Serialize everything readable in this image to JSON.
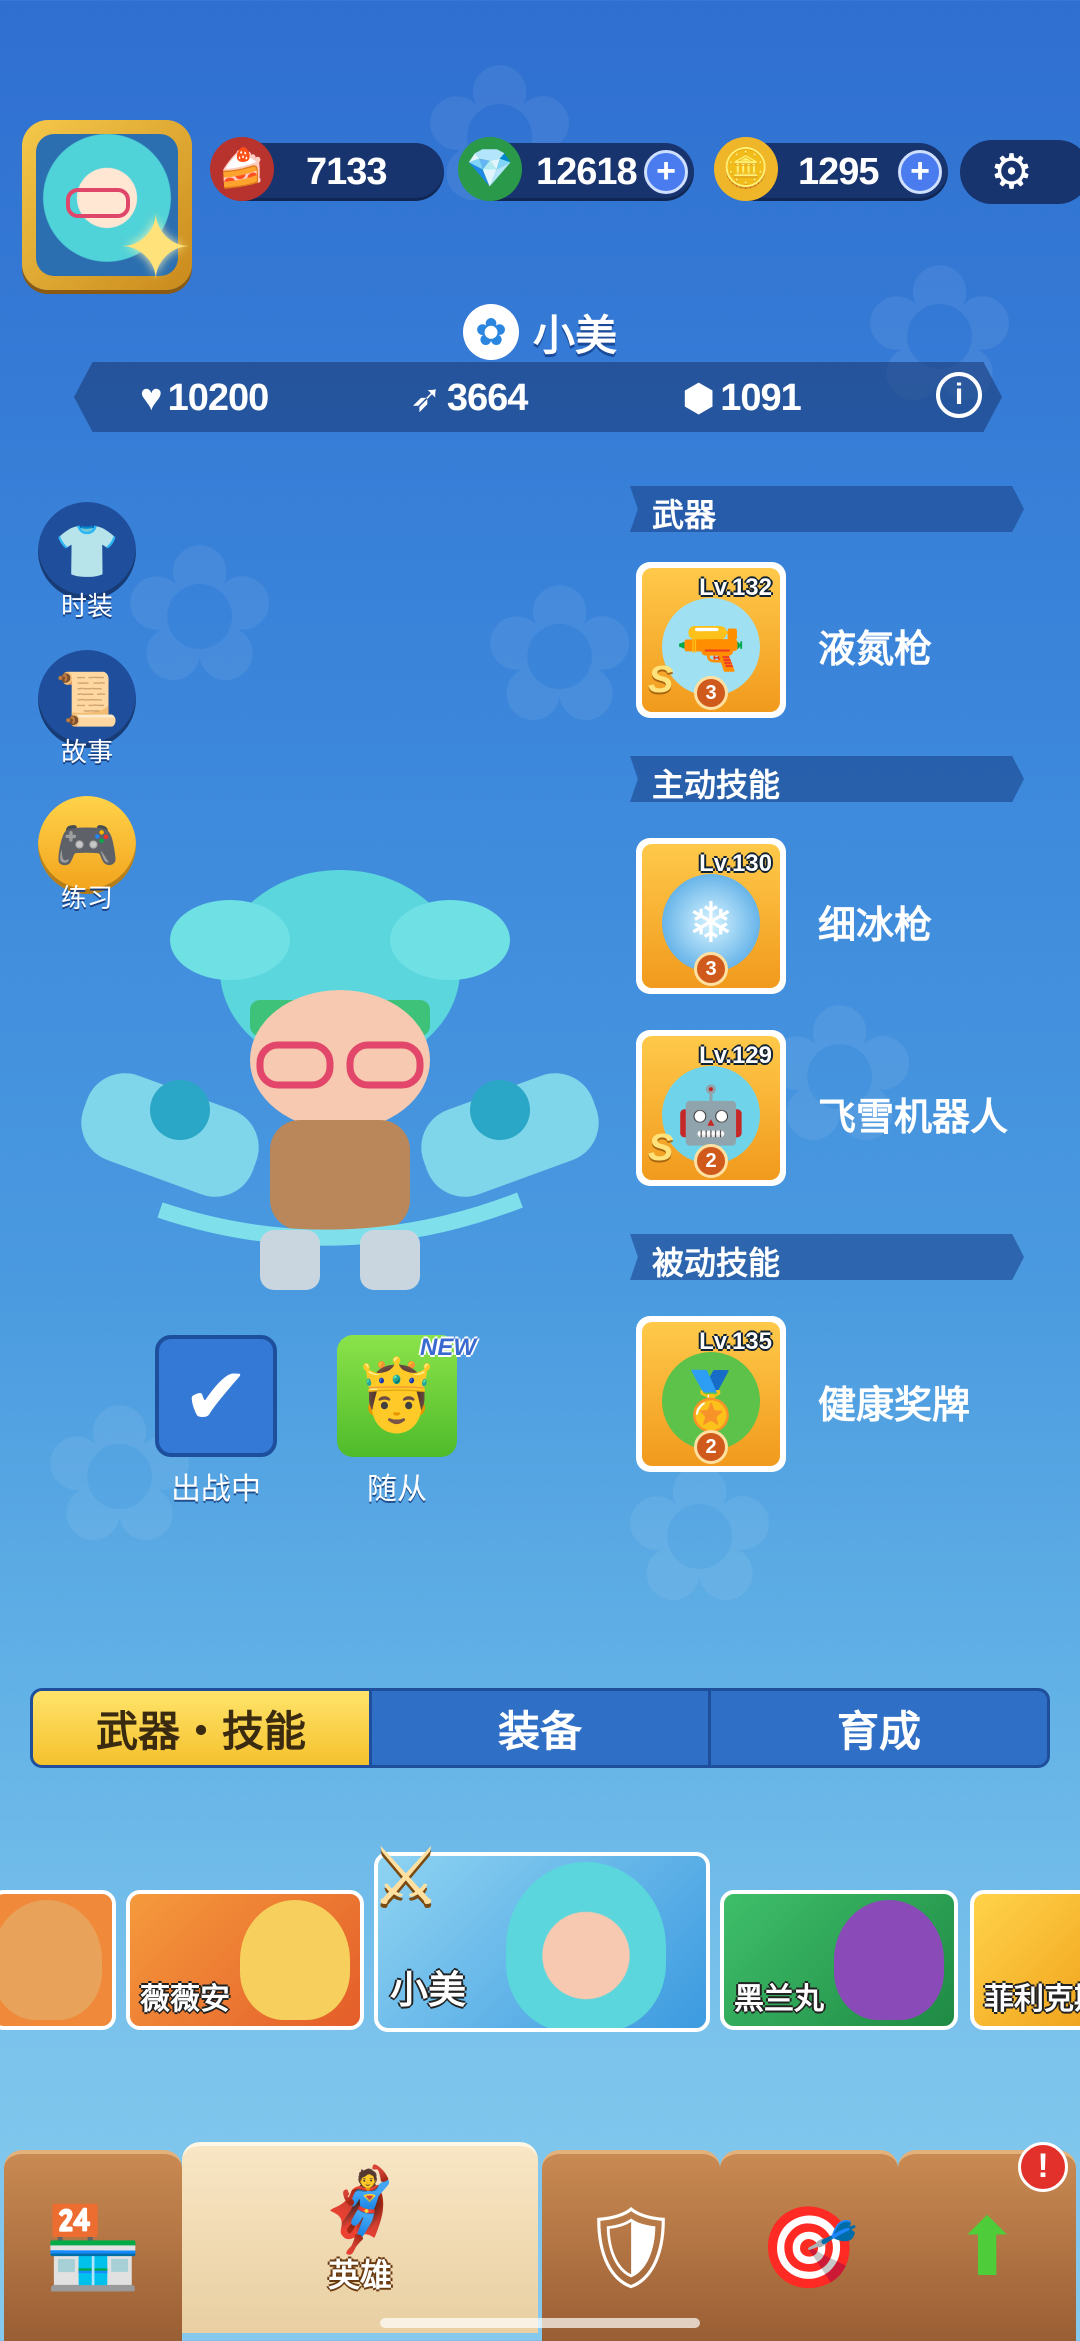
{
  "resources": {
    "cake": "7133",
    "gems": "12618",
    "coins": "1295"
  },
  "hero": {
    "name": "小美",
    "health": "10200",
    "attack": "3664",
    "defense": "1091"
  },
  "side_menu": {
    "fashion": "时装",
    "story": "故事",
    "practice": "练习"
  },
  "sections": {
    "weapon": "武器",
    "active_skill": "主动技能",
    "passive_skill": "被动技能"
  },
  "items": {
    "weapon": {
      "level": "Lv.132",
      "name": "液氮枪",
      "stars": "3",
      "grade": "S"
    },
    "active1": {
      "level": "Lv.130",
      "name": "细冰枪",
      "stars": "3",
      "grade": ""
    },
    "active2": {
      "level": "Lv.129",
      "name": "飞雪机器人",
      "stars": "2",
      "grade": "S"
    },
    "passive": {
      "level": "Lv.135",
      "name": "健康奖牌",
      "stars": "2",
      "grade": ""
    }
  },
  "actions": {
    "deployed": "出战中",
    "follower": "随从",
    "new_tag": "NEW"
  },
  "tabs": [
    "武器・技能",
    "装备",
    "育成"
  ],
  "carousel": {
    "hero1": "薇薇安",
    "hero2": "小美",
    "hero3": "黑兰丸",
    "hero4": "菲利克斯"
  },
  "nav": {
    "hero_label": "英雄",
    "alert": "!"
  },
  "colors": {
    "accent_yellow": "#f5c12e",
    "panel_navy": "#17346f",
    "plus_blue": "#4a7cf0"
  }
}
